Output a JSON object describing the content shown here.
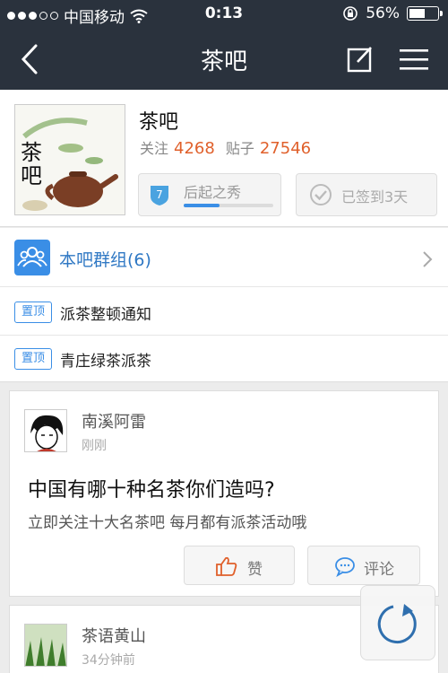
{
  "status_bar": {
    "carrier": "中国移动",
    "time": "0:13",
    "battery_percent": "56%",
    "battery_level": 0.56
  },
  "nav": {
    "title": "茶吧"
  },
  "forum": {
    "name": "茶吧",
    "logo_text": "茶吧",
    "follow_label": "关注",
    "follow_count": "4268",
    "posts_label": "贴子",
    "posts_count": "27546",
    "level_number": "7",
    "level_title": "后起之秀",
    "level_progress": 0.4,
    "sign_label": "已签到3天"
  },
  "group": {
    "label": "本吧群组(6)"
  },
  "pinned": [
    {
      "tag": "置顶",
      "title": "派茶整顿通知"
    },
    {
      "tag": "置顶",
      "title": "青庄绿茶派茶"
    }
  ],
  "posts": [
    {
      "author": "南溪阿雷",
      "time": "刚刚",
      "title": "中国有哪十种名茶你们造吗?",
      "body": "立即关注十大名茶吧 每月都有派茶活动哦",
      "like_label": "赞",
      "comment_label": "评论"
    },
    {
      "author": "茶语黄山",
      "time": "34分钟前"
    }
  ],
  "colors": {
    "nav_bg": "#2a323d",
    "accent": "#3a8ee6",
    "count": "#e0602b"
  }
}
